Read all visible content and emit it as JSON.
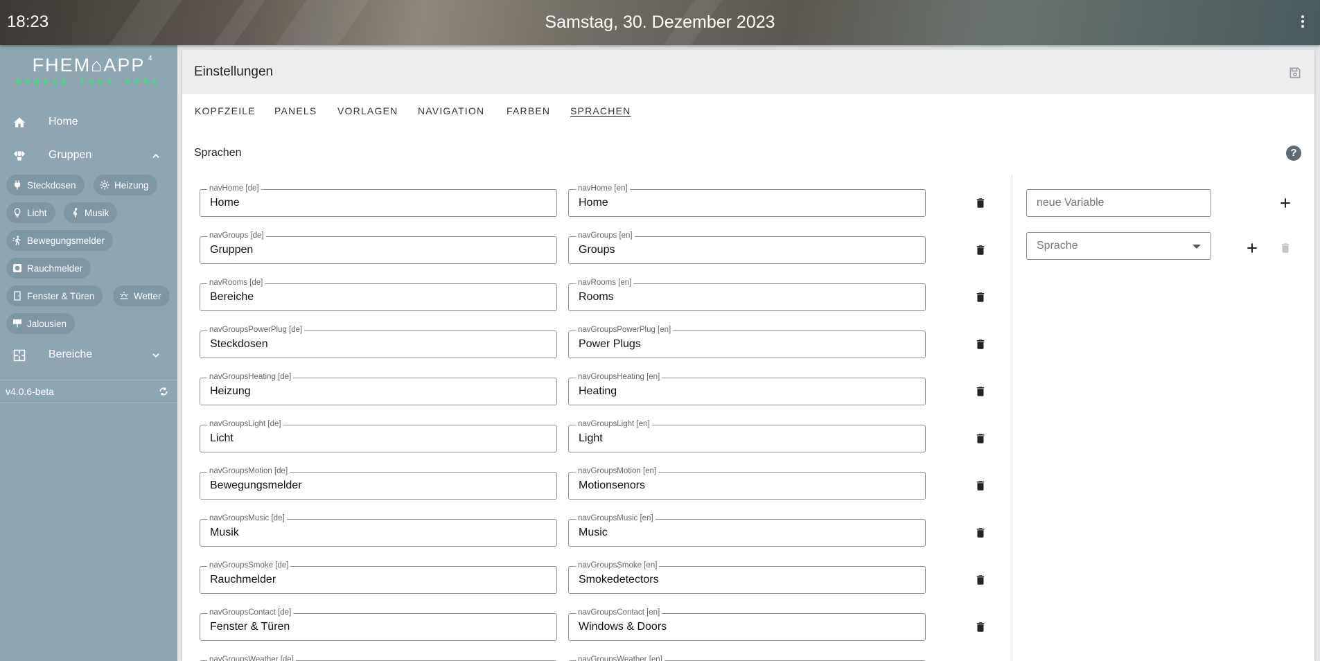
{
  "topbar": {
    "time": "18:23",
    "date": "Samstag, 30. Dezember 2023"
  },
  "sidebar": {
    "logo_main": "FHEM⌂APP",
    "logo_sup": "4",
    "logo_sub": "MANAGE YOUR HOME",
    "items": [
      {
        "label": "Home",
        "icon": "home-icon"
      },
      {
        "label": "Gruppen",
        "icon": "groups-icon"
      },
      {
        "label": "Bereiche",
        "icon": "floorplan-icon"
      }
    ],
    "chips": [
      {
        "label": "Steckdosen",
        "icon": "power-plug-icon"
      },
      {
        "label": "Heizung",
        "icon": "sun-heat-icon"
      },
      {
        "label": "Licht",
        "icon": "lightbulb-icon"
      },
      {
        "label": "Musik",
        "icon": "music-clef-icon"
      },
      {
        "label": "Bewegungsmelder",
        "icon": "motion-walk-icon"
      },
      {
        "label": "Rauchmelder",
        "icon": "smoke-detector-icon"
      },
      {
        "label": "Fenster & Türen",
        "icon": "door-icon"
      },
      {
        "label": "Wetter",
        "icon": "weather-icon"
      },
      {
        "label": "Jalousien",
        "icon": "blinds-icon"
      }
    ],
    "version": "v4.0.6-beta"
  },
  "card": {
    "title": "Einstellungen",
    "tabs": [
      "KOPFZEILE",
      "PANELS",
      "VORLAGEN",
      "NAVIGATION",
      "FARBEN",
      "SPRACHEN"
    ],
    "active_tab": "SPRACHEN",
    "section_title": "Sprachen",
    "help_glyph": "?"
  },
  "rows": [
    {
      "de_label": "navHome [de]",
      "de_value": "Home",
      "en_label": "navHome [en]",
      "en_value": "Home"
    },
    {
      "de_label": "navGroups [de]",
      "de_value": "Gruppen",
      "en_label": "navGroups [en]",
      "en_value": "Groups"
    },
    {
      "de_label": "navRooms [de]",
      "de_value": "Bereiche",
      "en_label": "navRooms [en]",
      "en_value": "Rooms"
    },
    {
      "de_label": "navGroupsPowerPlug [de]",
      "de_value": "Steckdosen",
      "en_label": "navGroupsPowerPlug [en]",
      "en_value": "Power Plugs"
    },
    {
      "de_label": "navGroupsHeating [de]",
      "de_value": "Heizung",
      "en_label": "navGroupsHeating [en]",
      "en_value": "Heating"
    },
    {
      "de_label": "navGroupsLight [de]",
      "de_value": "Licht",
      "en_label": "navGroupsLight [en]",
      "en_value": "Light"
    },
    {
      "de_label": "navGroupsMotion [de]",
      "de_value": "Bewegungsmelder",
      "en_label": "navGroupsMotion [en]",
      "en_value": "Motionsenors"
    },
    {
      "de_label": "navGroupsMusic [de]",
      "de_value": "Musik",
      "en_label": "navGroupsMusic [en]",
      "en_value": "Music"
    },
    {
      "de_label": "navGroupsSmoke [de]",
      "de_value": "Rauchmelder",
      "en_label": "navGroupsSmoke [en]",
      "en_value": "Smokedetectors"
    },
    {
      "de_label": "navGroupsContact [de]",
      "de_value": "Fenster & Türen",
      "en_label": "navGroupsContact [en]",
      "en_value": "Windows & Doors"
    },
    {
      "de_label": "navGroupsWeather [de]",
      "de_value": "",
      "en_label": "navGroupsWeather [en]",
      "en_value": ""
    }
  ],
  "right_panel": {
    "new_variable_placeholder": "neue Variable",
    "language_select_placeholder": "Sprache"
  },
  "colors": {
    "sidebar": "#8ea6b1",
    "chip": "#7e97a3",
    "accent_green": "#3ee07a",
    "card_header": "#eeeeee"
  }
}
